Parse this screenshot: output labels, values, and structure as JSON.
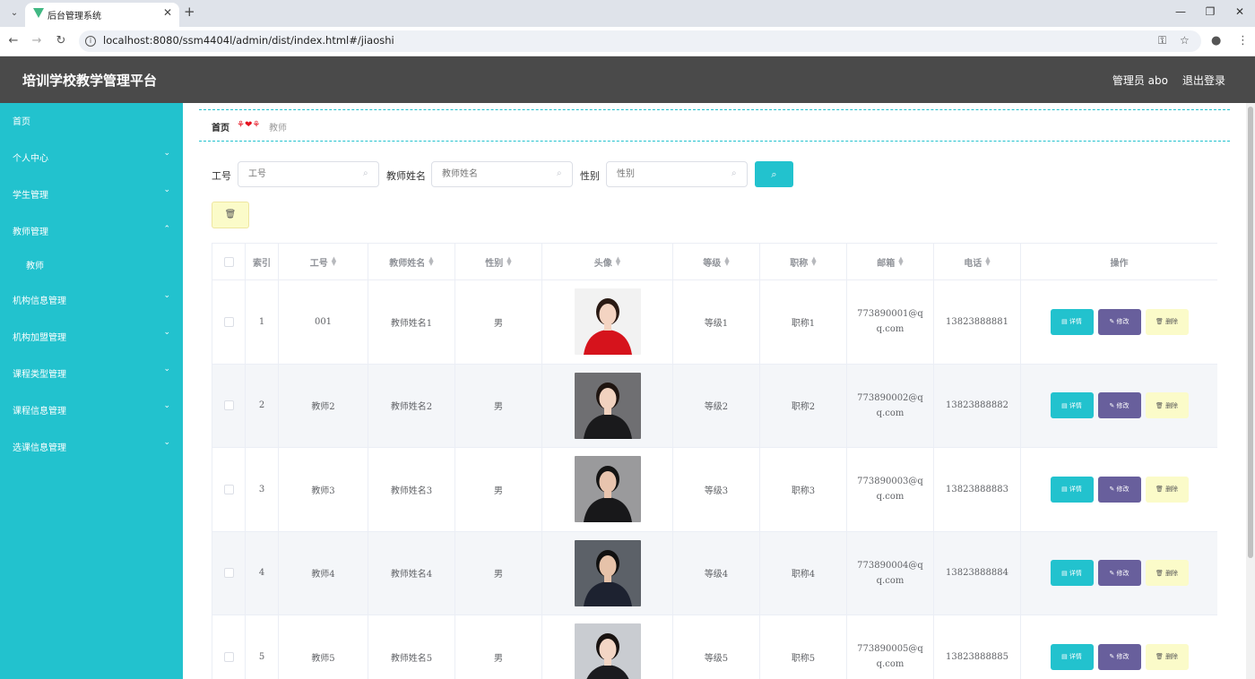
{
  "browser": {
    "tab_title": "后台管理系统",
    "url": "localhost:8080/ssm4404l/admin/dist/index.html#/jiaoshi"
  },
  "header": {
    "title": "培训学校教学管理平台",
    "admin_label": "管理员 abo",
    "logout_label": "退出登录"
  },
  "sidebar": {
    "items": [
      {
        "label": "首页"
      },
      {
        "label": "个人中心"
      },
      {
        "label": "学生管理"
      },
      {
        "label": "教师管理"
      },
      {
        "label": "教师"
      },
      {
        "label": "机构信息管理"
      },
      {
        "label": "机构加盟管理"
      },
      {
        "label": "课程类型管理"
      },
      {
        "label": "课程信息管理"
      },
      {
        "label": "选课信息管理"
      }
    ]
  },
  "breadcrumb": {
    "home": "首页",
    "separator": "⚘❤⚘",
    "current": "教师"
  },
  "search": {
    "gonghao_label": "工号",
    "gonghao_placeholder": "工号",
    "name_label": "教师姓名",
    "name_placeholder": "教师姓名",
    "gender_label": "性别",
    "gender_placeholder": "性别"
  },
  "table": {
    "headers": {
      "index": "索引",
      "gonghao": "工号",
      "name": "教师姓名",
      "gender": "性别",
      "avatar": "头像",
      "level": "等级",
      "title": "职称",
      "email": "邮箱",
      "phone": "电话",
      "ops": "操作"
    },
    "buttons": {
      "detail": "详情",
      "edit": "修改",
      "delete": "删除"
    },
    "rows": [
      {
        "index": "1",
        "gonghao": "001",
        "name": "教师姓名1",
        "gender": "男",
        "level": "等级1",
        "title": "职称1",
        "email": "773890001@qq.com",
        "phone": "13823888881"
      },
      {
        "index": "2",
        "gonghao": "教师2",
        "name": "教师姓名2",
        "gender": "男",
        "level": "等级2",
        "title": "职称2",
        "email": "773890002@qq.com",
        "phone": "13823888882"
      },
      {
        "index": "3",
        "gonghao": "教师3",
        "name": "教师姓名3",
        "gender": "男",
        "level": "等级3",
        "title": "职称3",
        "email": "773890003@qq.com",
        "phone": "13823888883"
      },
      {
        "index": "4",
        "gonghao": "教师4",
        "name": "教师姓名4",
        "gender": "男",
        "level": "等级4",
        "title": "职称4",
        "email": "773890004@qq.com",
        "phone": "13823888884"
      },
      {
        "index": "5",
        "gonghao": "教师5",
        "name": "教师姓名5",
        "gender": "男",
        "level": "等级5",
        "title": "职称5",
        "email": "773890005@qq.com",
        "phone": "13823888885"
      }
    ]
  }
}
